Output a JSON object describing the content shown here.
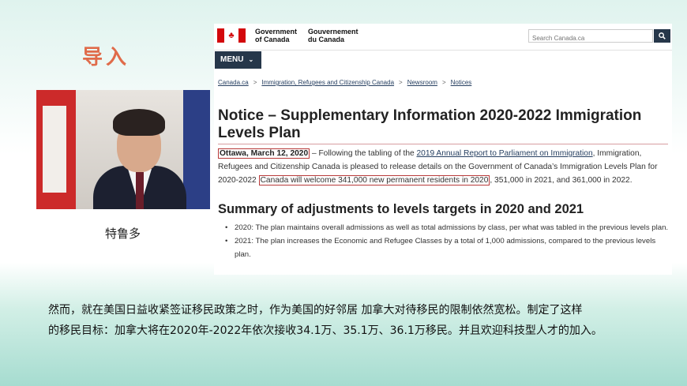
{
  "slide": {
    "title": "导入",
    "caption": "特鲁多",
    "body_line1": "然而，就在美国日益收紧签证移民政策之时，作为美国的好邻居 加拿大对待移民的限制依然宽松。制定了这样",
    "body_line2": "的移民目标：加拿大将在2020年-2022年依次接收34.1万、35.1万、36.1万移民。并且欢迎科技型人才的加入。"
  },
  "screenshot": {
    "gov_en_line1": "Government",
    "gov_en_line2": "of Canada",
    "gov_fr_line1": "Gouvernement",
    "gov_fr_line2": "du Canada",
    "search_placeholder": "Search Canada.ca",
    "menu_label": "MENU",
    "breadcrumb": [
      "Canada.ca",
      "Immigration, Refugees and Citizenship Canada",
      "Newsroom",
      "Notices"
    ],
    "title": "Notice – Supplementary Information 2020-2022 Immigration Levels Plan",
    "para": {
      "date": "Ottawa, March 12, 2020",
      "t1": " – Following the tabling of the ",
      "link": "2019 Annual Report to Parliament on Immigration",
      "t2": ", Immigration, Refugees and Citizenship Canada is pleased to release details on the Government of Canada’s Immigration Levels Plan for 2020-2022 ",
      "highlight": "Canada will welcome 341,000 new permanent residents in 2020",
      "t3": ", 351,000 in 2021, and 361,000 in 2022."
    },
    "summary_title": "Summary of adjustments to levels targets in 2020 and 2021",
    "bullets": [
      "2020: The plan maintains overall admissions as well as total admissions by class, per what was tabled in the previous levels plan.",
      "2021: The plan increases the Economic and Refugee Classes by a total of 1,000 admissions, compared to the previous levels plan."
    ]
  },
  "colors": {
    "accent_title": "#e06b4a",
    "gc_navy": "#26374a",
    "canada_red": "#d3080c",
    "highlight_box": "#b83a3a"
  },
  "icons": [
    "canada-flag-icon",
    "search-icon",
    "chevron-down-icon",
    "maple-leaf-icon"
  ]
}
